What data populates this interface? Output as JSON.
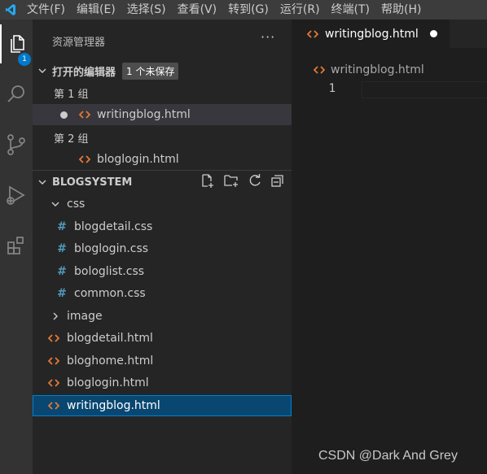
{
  "menu": [
    "文件(F)",
    "编辑(E)",
    "选择(S)",
    "查看(V)",
    "转到(G)",
    "运行(R)",
    "终端(T)",
    "帮助(H)"
  ],
  "activity_bar": {
    "items": [
      "explorer-icon",
      "search-icon",
      "source-control-icon",
      "run-debug-icon",
      "extensions-icon"
    ],
    "explorer_badge": "1"
  },
  "sidebar": {
    "title": "资源管理器",
    "more": "···",
    "open_editors": {
      "label": "打开的编辑器",
      "badge": "1 个未保存",
      "groups": [
        {
          "label": "第 1 组",
          "files": [
            {
              "name": "writingblog.html",
              "modified": true
            }
          ]
        },
        {
          "label": "第 2 组",
          "files": [
            {
              "name": "bloglogin.html",
              "modified": false
            }
          ]
        }
      ]
    },
    "workspace": {
      "label": "BLOGSYSTEM",
      "actions": [
        "new-file-icon",
        "new-folder-icon",
        "refresh-icon",
        "collapse-all-icon"
      ],
      "css_folder": "css",
      "css_files": [
        "blogdetail.css",
        "bloglogin.css",
        "bologlist.css",
        "common.css"
      ],
      "image_folder": "image",
      "html_files": [
        "blogdetail.html",
        "bloghome.html",
        "bloglogin.html",
        "writingblog.html"
      ]
    }
  },
  "editor": {
    "tab": "writingblog.html",
    "breadcrumb": "writingblog.html",
    "line_numbers": [
      "1"
    ]
  },
  "watermark": "CSDN @Dark And Grey",
  "colors": {
    "accent": "#007acc",
    "html_icon": "#e37933",
    "css_icon": "#519aba",
    "selection": "#094771"
  }
}
